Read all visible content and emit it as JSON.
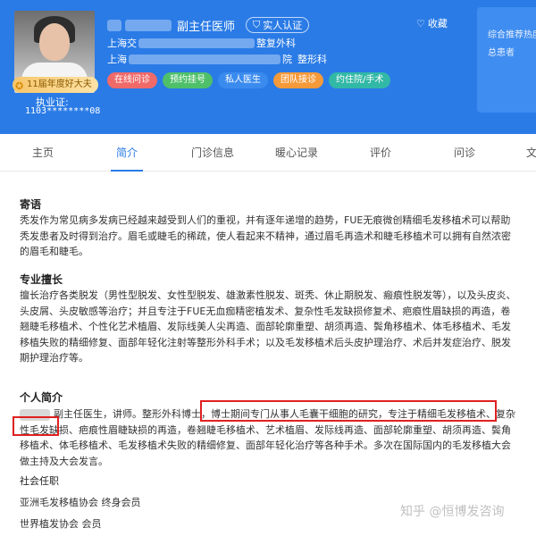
{
  "header": {
    "doctor_title": "副主任医师",
    "verified_label": "实人认证",
    "collect_label": "收藏",
    "hospital_line1": {
      "prefix": "上海交",
      "suffix": "整复外科"
    },
    "hospital_line2": {
      "prefix": "上海",
      "middle": "院",
      "suffix": "整形科"
    },
    "award_label": "11届年度好大夫",
    "license_label": "执业证:",
    "license_number": "1103********08",
    "pills": [
      {
        "label": "在线问诊",
        "color": "#f06a6a"
      },
      {
        "label": "预约挂号",
        "color": "#4fc06a"
      },
      {
        "label": "私人医生",
        "color": "#3b8bef"
      },
      {
        "label": "团队接诊",
        "color": "#f59a3a"
      },
      {
        "label": "约住院/手术",
        "color": "#32b8a6"
      }
    ],
    "side_panel": {
      "line1": "综合推荐热度",
      "line2": "总患者"
    }
  },
  "tabs": [
    "主页",
    "简介",
    "门诊信息",
    "暖心记录",
    "评价",
    "问诊",
    "文"
  ],
  "active_tab": "简介",
  "sections": {
    "message": {
      "title": "寄语",
      "text": "秃发作为常见病多发病已经越来越受到人们的重视，并有逐年递增的趋势，FUE无痕微创精细毛发移植术可以帮助秃发患者及时得到治疗。眉毛或睫毛的稀疏，使人看起来不精神，通过眉毛再造术和睫毛移植术可以拥有自然浓密的眉毛和睫毛。"
    },
    "expertise": {
      "title": "专业擅长",
      "text": "擅长治疗各类脱发（男性型脱发、女性型脱发、雄激素性脱发、斑秃、休止期脱发、瘢痕性脱发等），以及头皮炎、头皮屑、头皮敏感等治疗；并且专注于FUE无血痂精密植发术、复杂性毛发缺损修复术、疤痕性眉缺损的再造，卷翘睫毛移植术、个性化艺术植眉、发际线美人尖再造、面部轮廓重塑、胡须再造、鬓角移植术、体毛移植术、毛发移植失败的精细修复、面部年轻化注射等整形外科手术；以及毛发移植术后头皮护理治疗、术后并发症治疗、脱发期护理治疗等。"
    },
    "bio": {
      "title": "个人简介",
      "text": "副主任医生，讲师。整形外科博士，博士期间专门从事人毛囊干细胞的研究，专注于精细毛发移植术、复杂性毛发缺损、疤痕性眉睫缺损的再造，卷翘睫毛移植术、艺术植眉、发际线再造、面部轮廓重塑、胡须再造、鬓角移植术、体毛移植术、毛发移植术失败的精细修复、面部年轻化治疗等各种手术。多次在国际国内的毛发移植大会做主持及大会发言。"
    },
    "social": {
      "title": "社会任职",
      "items": [
        "亚洲毛发移植协会 终身会员",
        "世界植发协会 会员"
      ]
    }
  },
  "watermark": "知乎 @恒博发咨询",
  "colors": {
    "brand_blue": "#2a7be6",
    "highlight_red": "#e02020"
  }
}
